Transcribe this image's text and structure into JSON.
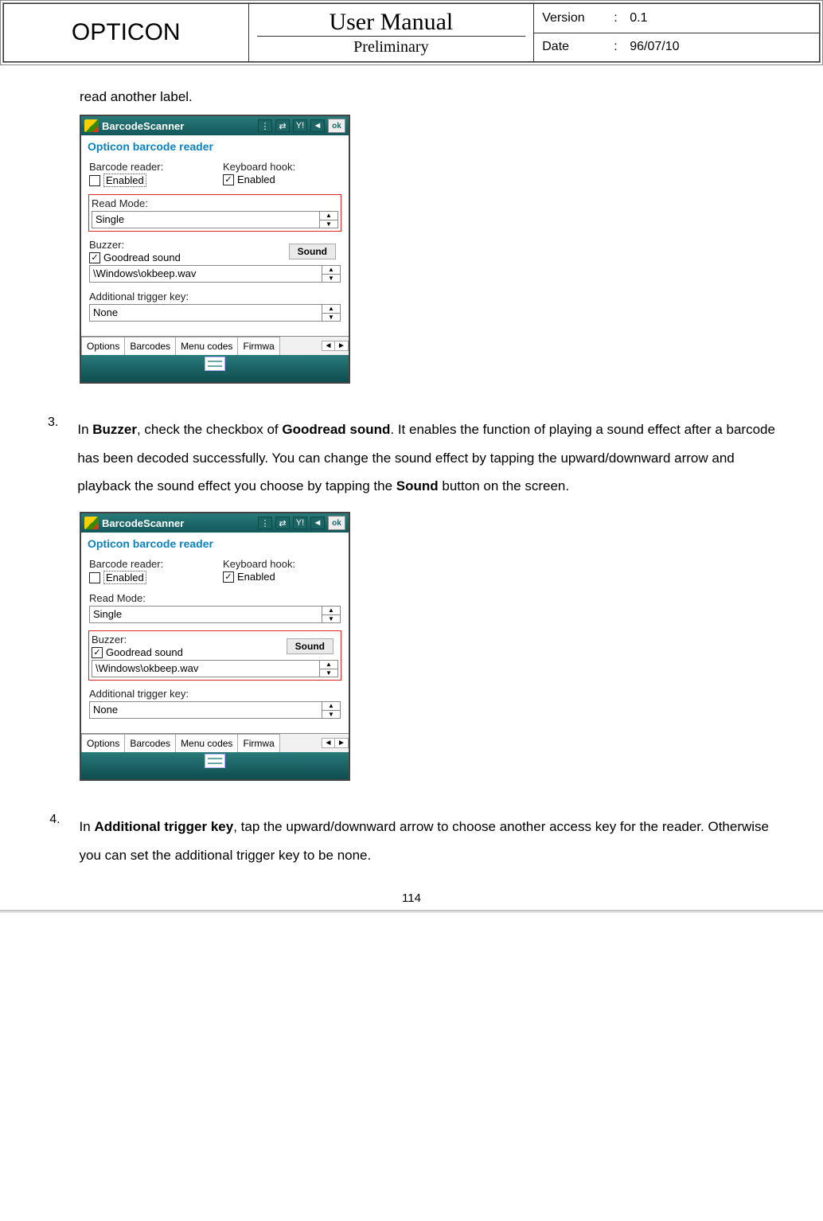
{
  "header": {
    "brand": "OPTICON",
    "title": "User Manual",
    "subtitle": "Preliminary",
    "version_label": "Version",
    "version_value": "0.1",
    "date_label": "Date",
    "date_value": "96/07/10"
  },
  "intro_text": "read another label.",
  "screenshot": {
    "titlebar": "BarcodeScanner",
    "ok": "ok",
    "subtitle": "Opticon barcode reader",
    "barcode_reader_label": "Barcode reader:",
    "barcode_reader_enabled": "Enabled",
    "barcode_reader_checked": false,
    "keyboard_hook_label": "Keyboard hook:",
    "keyboard_hook_enabled": "Enabled",
    "keyboard_hook_checked": true,
    "read_mode_label": "Read Mode:",
    "read_mode_value": "Single",
    "buzzer_label": "Buzzer:",
    "goodread_label": "Goodread sound",
    "goodread_checked": true,
    "sound_button": "Sound",
    "sound_path": "\\Windows\\okbeep.wav",
    "additional_trigger_label": "Additional trigger key:",
    "additional_trigger_value": "None",
    "tabs": [
      "Options",
      "Barcodes",
      "Menu codes",
      "Firmwa"
    ],
    "highlight_mode": "readmode"
  },
  "screenshot2_highlight": "buzzer",
  "step3": {
    "num": "3.",
    "t1": "In ",
    "b1": "Buzzer",
    "t2": ", check the checkbox of ",
    "b2": "Goodread sound",
    "t3": ". It enables the function of playing a sound effect after a barcode has been decoded successfully. You can change the sound effect by tapping the upward/downward arrow and playback the sound effect you choose by tapping the ",
    "b3": "Sound",
    "t4": " button on the screen."
  },
  "step4": {
    "num": "4.",
    "t1": "In ",
    "b1": "Additional trigger key",
    "t2": ", tap the upward/downward arrow to choose another access key for the reader. Otherwise you can set the additional trigger key to be none."
  },
  "page_number": "114"
}
